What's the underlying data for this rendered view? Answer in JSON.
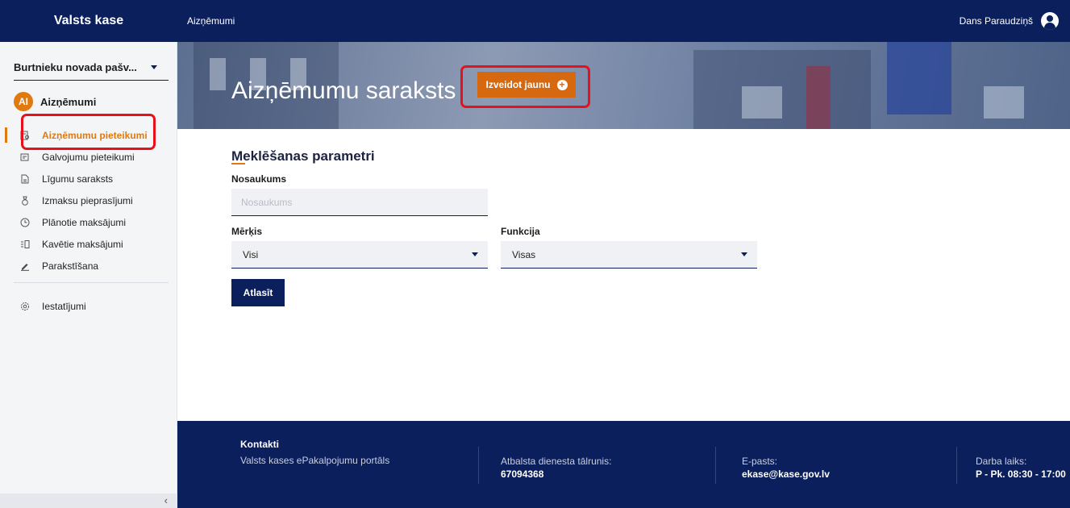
{
  "topbar": {
    "brand": "Valsts kase",
    "breadcrumb": "Aizņēmumi",
    "user_name": "Dans Paraudziņš"
  },
  "sidebar": {
    "organization": "Burtnieku novada pašv...",
    "section_avatar": "AI",
    "section_title": "Aizņēmumi",
    "items": [
      {
        "label": "Aizņēmumu pieteikumi",
        "icon": "application-icon",
        "active": true
      },
      {
        "label": "Galvojumu pieteikumi",
        "icon": "guarantee-icon",
        "active": false
      },
      {
        "label": "Līgumu saraksts",
        "icon": "document-icon",
        "active": false
      },
      {
        "label": "Izmaksu pieprasījumi",
        "icon": "money-bag-icon",
        "active": false
      },
      {
        "label": "Plānotie maksājumi",
        "icon": "clock-icon",
        "active": false
      },
      {
        "label": "Kavētie maksājumi",
        "icon": "late-payment-icon",
        "active": false
      },
      {
        "label": "Parakstīšana",
        "icon": "signature-icon",
        "active": false
      }
    ],
    "settings_label": "Iestatījumi",
    "collapse_icon": "‹"
  },
  "hero": {
    "title": "Aizņēmumu saraksts",
    "new_button": "Izveidot jaunu"
  },
  "search": {
    "title": "Meklēšanas parametri",
    "name_label": "Nosaukums",
    "name_placeholder": "Nosaukums",
    "goal_label": "Mērķis",
    "goal_value": "Visi",
    "function_label": "Funkcija",
    "function_value": "Visas",
    "submit_label": "Atlasīt"
  },
  "footer": {
    "contacts_title": "Kontakti",
    "portal": "Valsts kases ePakalpojumu portāls",
    "phone_label": "Atbalsta dienesta tālrunis:",
    "phone": "67094368",
    "email_label": "E-pasts:",
    "email": "ekase@kase.gov.lv",
    "hours_label": "Darba laiks:",
    "hours": "P - Pk. 08:30 - 17:00"
  },
  "colors": {
    "navy": "#0b1f5c",
    "accent": "#e07a10",
    "highlight": "#e8101a"
  }
}
